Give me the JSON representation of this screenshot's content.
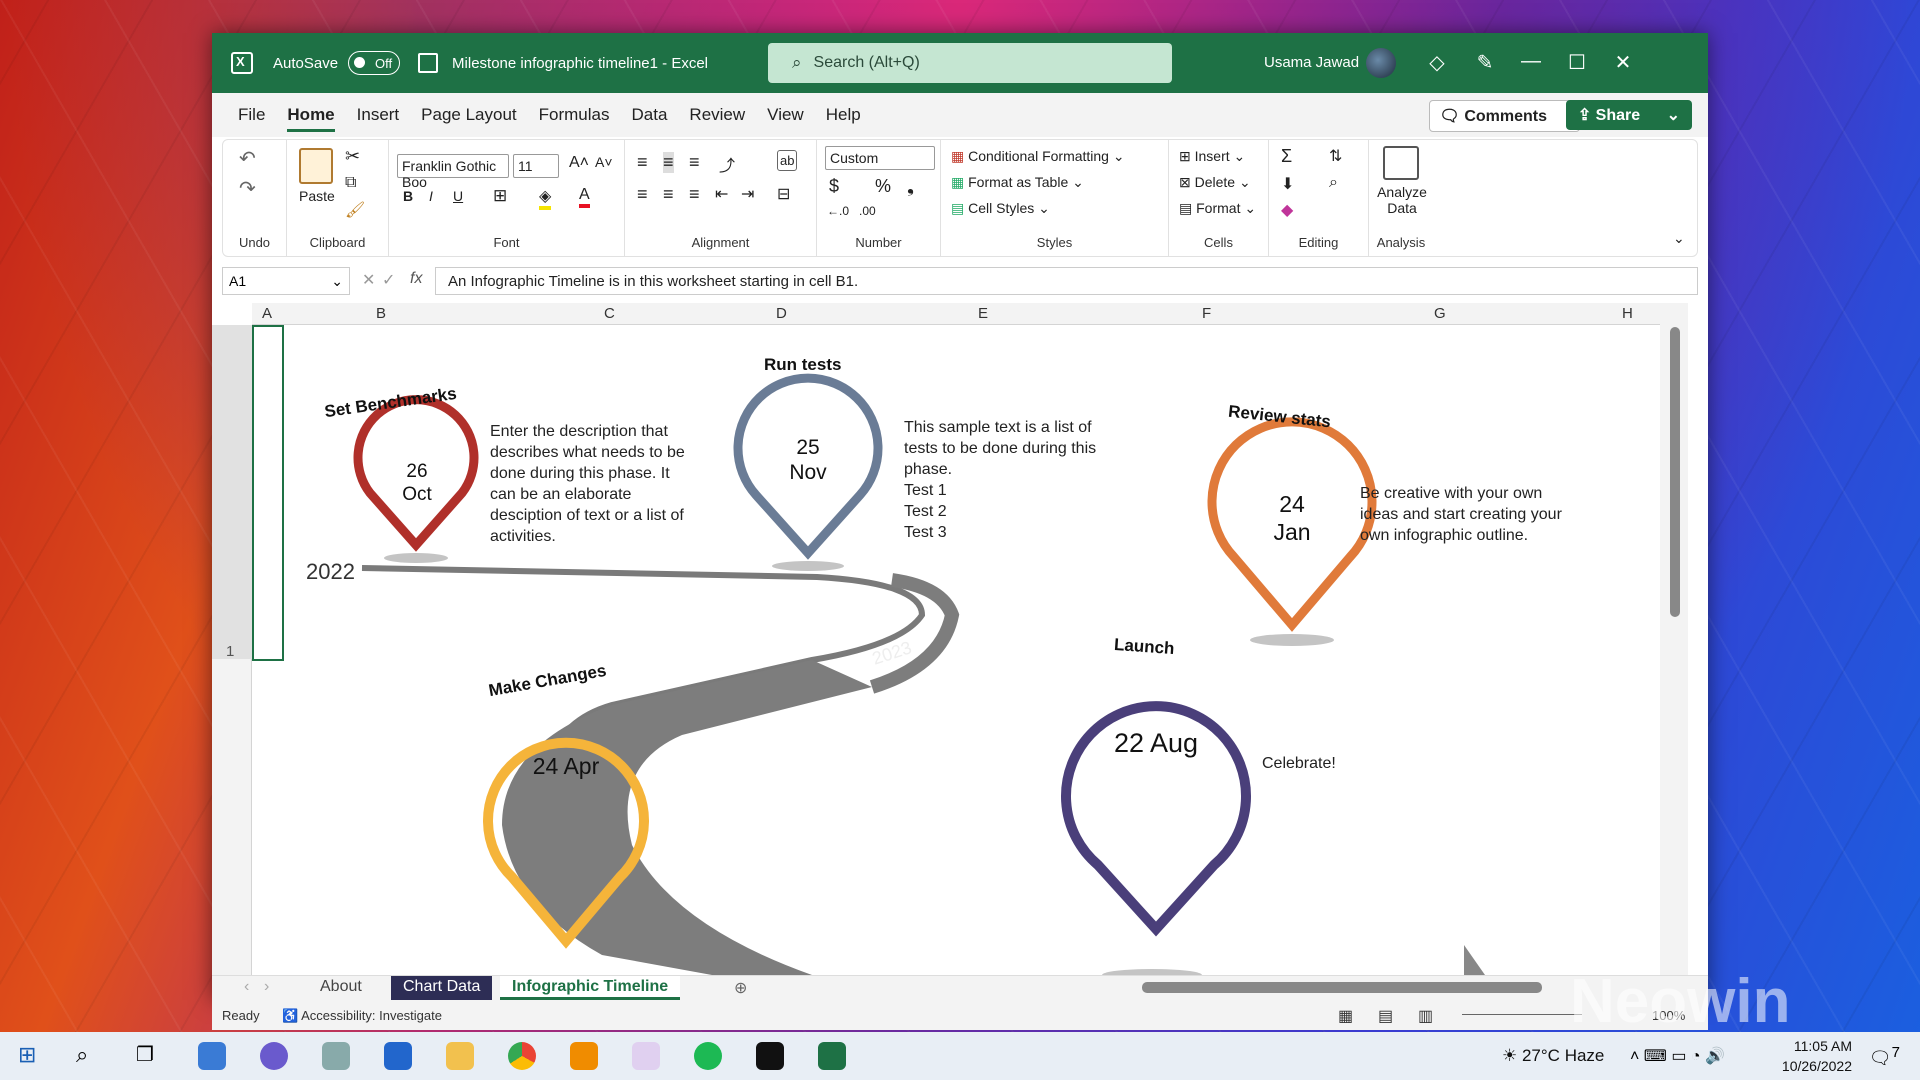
{
  "window": {
    "autosave_label": "AutoSave",
    "autosave_state": "Off",
    "document_title": "Milestone infographic timeline1  -  Excel",
    "search_placeholder": "Search (Alt+Q)",
    "user_name": "Usama Jawad"
  },
  "menu": {
    "items": [
      "File",
      "Home",
      "Insert",
      "Page Layout",
      "Formulas",
      "Data",
      "Review",
      "View",
      "Help"
    ],
    "comments": "Comments",
    "share": "Share"
  },
  "ribbon": {
    "undo_label": "Undo",
    "clipboard_label": "Clipboard",
    "paste_label": "Paste",
    "font_label": "Font",
    "font_name": "Franklin Gothic Boo",
    "font_size": "11",
    "bold": "B",
    "italic": "I",
    "underline": "U",
    "alignment_label": "Alignment",
    "number_label": "Number",
    "number_format": "Custom",
    "styles_label": "Styles",
    "cond_format": "Conditional Formatting",
    "format_table": "Format as Table",
    "cell_styles": "Cell Styles",
    "cells_label": "Cells",
    "insert": "Insert",
    "delete": "Delete",
    "format": "Format",
    "editing_label": "Editing",
    "analysis_label": "Analysis",
    "analyze_data": "Analyze Data"
  },
  "formula_bar": {
    "name_box": "A1",
    "fx": "fx",
    "formula": "An Infographic Timeline is in this worksheet starting in cell B1."
  },
  "columns": [
    "A",
    "B",
    "C",
    "D",
    "E",
    "F",
    "G",
    "H"
  ],
  "row_number": "1",
  "infographic": {
    "year1": "2022",
    "year2": "2023",
    "milestones": [
      {
        "title": "Set Benchmarks",
        "day": "26",
        "month": "Oct",
        "color": "#b0302a",
        "desc": [
          "Enter the description that",
          "describes what needs to be",
          "done during this phase. It",
          "can be an elaborate",
          "desciption of text or a list of",
          "activities."
        ]
      },
      {
        "title": "Run tests",
        "day": "25",
        "month": "Nov",
        "color": "#6a7c96",
        "desc": [
          "This sample text is a list of",
          "tests to be done during this",
          "phase.",
          "Test 1",
          "Test 2",
          "Test 3"
        ]
      },
      {
        "title": "Review  stats",
        "day": "24",
        "month": "Jan",
        "color": "#e07a3a",
        "desc": [
          "Be creative with your own",
          "ideas and start creating your",
          "own infographic outline."
        ]
      },
      {
        "title": "Make Changes",
        "day": "24 Apr",
        "month": "",
        "color": "#f5b43a",
        "desc": []
      },
      {
        "title": "Launch",
        "day": "22 Aug",
        "month": "",
        "color": "#4a3f7a",
        "desc": [
          "Celebrate!"
        ]
      }
    ]
  },
  "sheet_tabs": [
    "About",
    "Chart Data",
    "Infographic Timeline"
  ],
  "status": {
    "ready": "Ready",
    "accessibility": "Accessibility: Investigate",
    "zoom": "100%"
  },
  "taskbar": {
    "temperature": "27°C",
    "weather": "Haze",
    "time": "11:05 AM",
    "date": "10/26/2022",
    "notifications": "7"
  },
  "watermark": "Neowin"
}
